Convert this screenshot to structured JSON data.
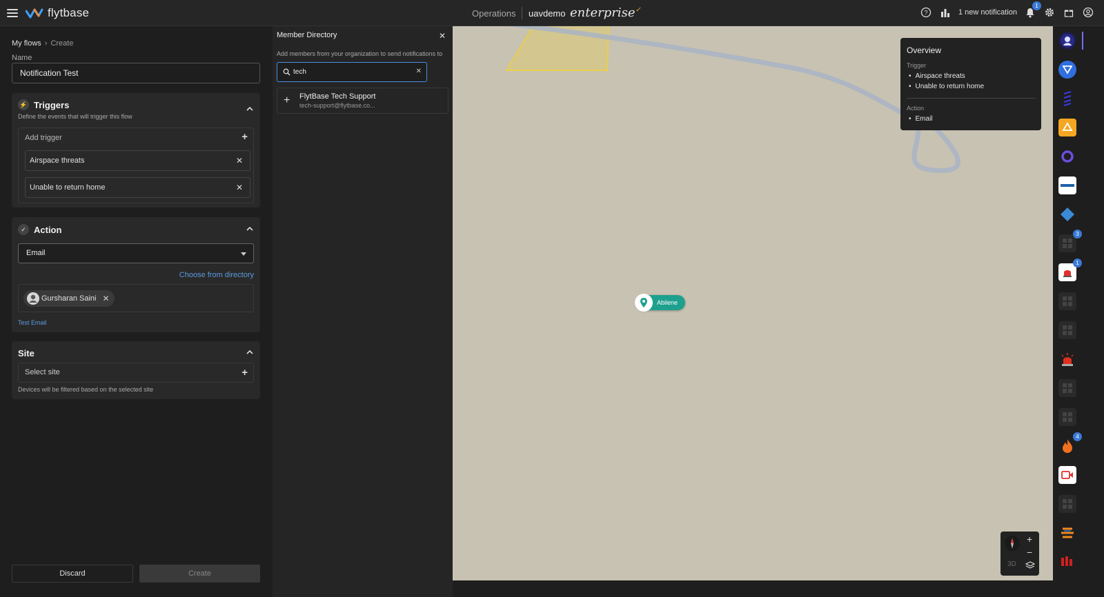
{
  "topbar": {
    "logo_text": "flytbase",
    "nav_operations": "Operations",
    "org_name": "uavdemo",
    "edition": "enterprise",
    "notification_text": "1 new notification",
    "notification_count": "1"
  },
  "flow": {
    "breadcrumb_root": "My flows",
    "breadcrumb_current": "Create",
    "name_label": "Name",
    "name_value": "Notification Test",
    "triggers": {
      "title": "Triggers",
      "subtitle": "Define the events that will trigger this flow",
      "add_label": "Add trigger",
      "items": [
        "Airspace threats",
        "Unable to return home"
      ]
    },
    "action": {
      "title": "Action",
      "selected": "Email",
      "directory_link": "Choose from directory",
      "recipients": [
        "Gursharan Saini"
      ],
      "test_link": "Test Email"
    },
    "site": {
      "title": "Site",
      "select_label": "Select site",
      "hint": "Devices will be filtered based on the selected site"
    },
    "discard_label": "Discard",
    "create_label": "Create"
  },
  "directory": {
    "title": "Member Directory",
    "description": "Add members from your organization to send notifications to",
    "search_value": "tech",
    "results": [
      {
        "name": "FlytBase Tech Support",
        "email": "tech-support@flytbase.co..."
      }
    ]
  },
  "map": {
    "overview": {
      "title": "Overview",
      "trigger_label": "Trigger",
      "triggers": [
        "Airspace threats",
        "Unable to return home"
      ],
      "action_label": "Action",
      "actions": [
        "Email"
      ]
    },
    "site_pin_label": "Abilene",
    "view_mode": "3D"
  },
  "rail": {
    "badges": {
      "item8": "3",
      "item9": "1",
      "item15": "4"
    }
  },
  "colors": {
    "accent": "#4a90e2",
    "link": "#5b9be0",
    "pin": "#1ea08e",
    "geofence": "#e8cf4d",
    "map_bg": "#c8c2b2"
  }
}
